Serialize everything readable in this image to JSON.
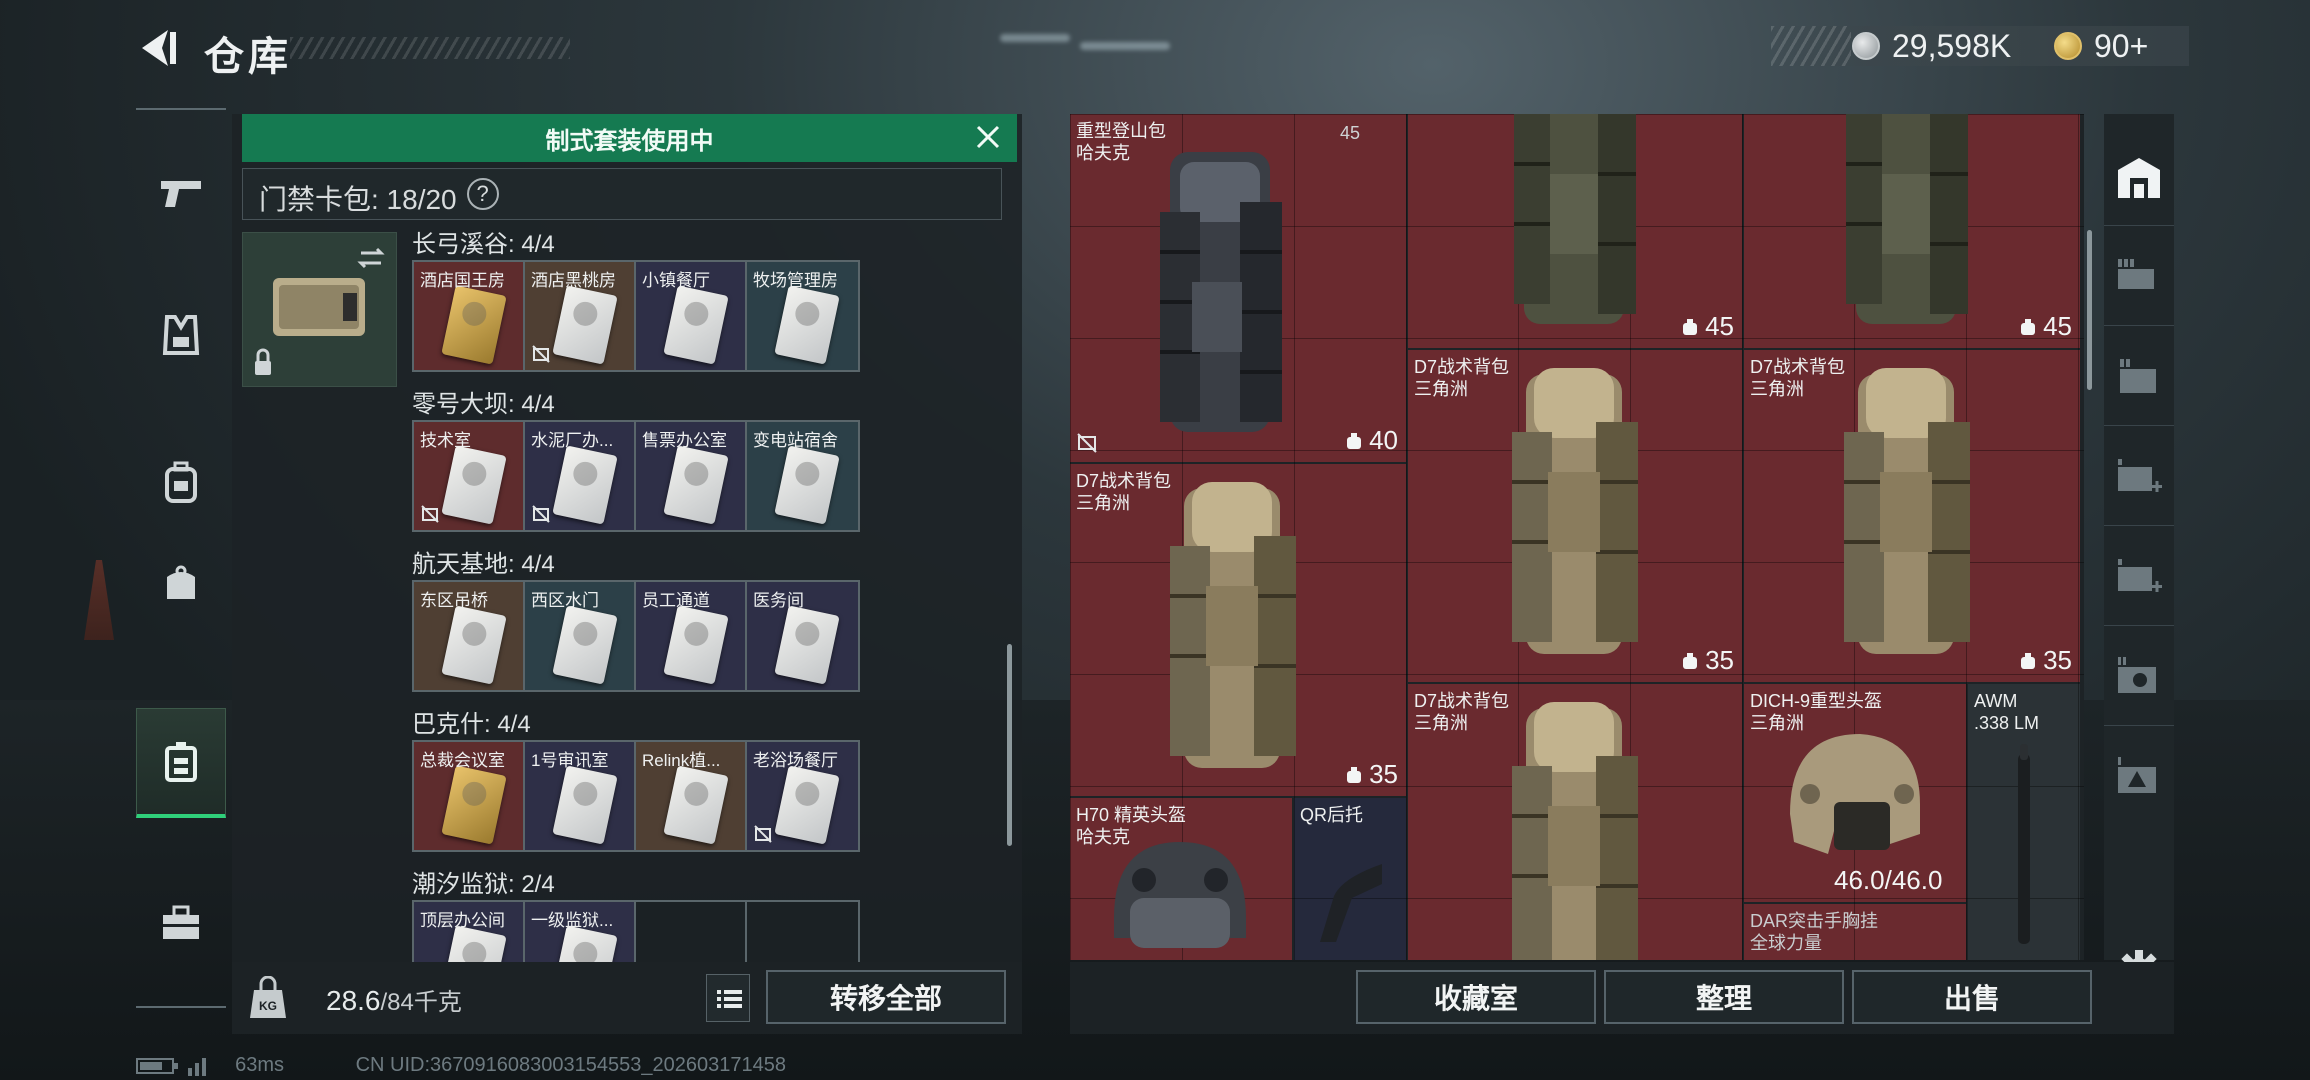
{
  "header": {
    "title": "仓库",
    "currency_silver": "29,598K",
    "currency_gold": "90+"
  },
  "nav": {
    "items": [
      "weapon",
      "armor-vest",
      "backpack",
      "helmet-bag",
      "key-case",
      "toolbox"
    ]
  },
  "keypanel": {
    "banner": "制式套装使用中",
    "count_label": "门禁卡包: 18/20",
    "help": "?",
    "locations": [
      {
        "title": "长弓溪谷: 4/4",
        "cards": [
          {
            "label": "酒店国王房",
            "bg": "red",
            "gold": true,
            "no_trade": false
          },
          {
            "label": "酒店黑桃房",
            "bg": "brown",
            "gold": false,
            "no_trade": true
          },
          {
            "label": "小镇餐厅",
            "bg": "navy",
            "gold": false,
            "no_trade": false
          },
          {
            "label": "牧场管理房",
            "bg": "slate",
            "gold": false,
            "no_trade": false
          }
        ]
      },
      {
        "title": "零号大坝: 4/4",
        "cards": [
          {
            "label": "技术室",
            "bg": "red",
            "gold": false,
            "no_trade": true
          },
          {
            "label": "水泥厂办...",
            "bg": "navy",
            "gold": false,
            "no_trade": true
          },
          {
            "label": "售票办公室",
            "bg": "navy",
            "gold": false,
            "no_trade": false
          },
          {
            "label": "变电站宿舍",
            "bg": "slate",
            "gold": false,
            "no_trade": false
          }
        ]
      },
      {
        "title": "航天基地: 4/4",
        "cards": [
          {
            "label": "东区吊桥",
            "bg": "brown",
            "gold": false,
            "no_trade": false
          },
          {
            "label": "西区水门",
            "bg": "slate",
            "gold": false,
            "no_trade": false
          },
          {
            "label": "员工通道",
            "bg": "navy",
            "gold": false,
            "no_trade": false
          },
          {
            "label": "医务间",
            "bg": "navy",
            "gold": false,
            "no_trade": false
          }
        ]
      },
      {
        "title": "巴克什: 4/4",
        "cards": [
          {
            "label": "总裁会议室",
            "bg": "red",
            "gold": true,
            "no_trade": false
          },
          {
            "label": "1号审讯室",
            "bg": "navy",
            "gold": false,
            "no_trade": false
          },
          {
            "label": "Relink植...",
            "bg": "brown",
            "gold": false,
            "no_trade": false
          },
          {
            "label": "老浴场餐厅",
            "bg": "navy",
            "gold": false,
            "no_trade": true
          }
        ]
      },
      {
        "title": "潮汐监狱: 2/4",
        "cards": [
          {
            "label": "顶层办公间",
            "bg": "navy",
            "gold": false,
            "no_trade": false
          },
          {
            "label": "一级监狱...",
            "bg": "navy",
            "gold": false,
            "no_trade": false
          },
          {
            "label": "",
            "bg": "none",
            "gold": false,
            "no_trade": false
          },
          {
            "label": "",
            "bg": "none",
            "gold": false,
            "no_trade": false
          }
        ]
      }
    ]
  },
  "footer_left": {
    "weight": "28.6",
    "weight_unit": "/84千克",
    "kg_icon": "KG",
    "transfer_all": "转移全部"
  },
  "inventory": {
    "items": [
      {
        "name": "重型登山包\n哈夫克",
        "capacity": "40",
        "color": "black"
      },
      {
        "name": "",
        "capacity": "45",
        "color": "green"
      },
      {
        "name": "",
        "capacity": "45",
        "color": "green"
      },
      {
        "name": "D7战术背包\n三角洲",
        "capacity": "35",
        "color": "tan"
      },
      {
        "name": "D7战术背包\n三角洲",
        "capacity": "35",
        "color": "tan"
      },
      {
        "name": "D7战术背包\n三角洲",
        "capacity": "35",
        "color": "tan"
      },
      {
        "name": "D7战术背包\n三角洲",
        "capacity": "",
        "color": "tan"
      },
      {
        "name": "DICH-9重型头盔\n三角洲",
        "durability": "46.0/46.0"
      },
      {
        "name": "AWM\n.338 LM"
      },
      {
        "name": "H70 精英头盔\n哈夫克"
      },
      {
        "name": "QR后托"
      },
      {
        "name": "DAR突击手胸挂\n全球力量"
      }
    ],
    "top_partial_capacity": "45"
  },
  "footer_right": {
    "collection": "收藏室",
    "organize": "整理",
    "sell": "出售"
  },
  "status": {
    "ping": "63ms",
    "uid": "CN UID:3670916083003154553_202603171458"
  },
  "colors": {
    "accent_green": "#157a51",
    "active_green": "#2fd07a",
    "item_red": "#6a2a2f"
  }
}
